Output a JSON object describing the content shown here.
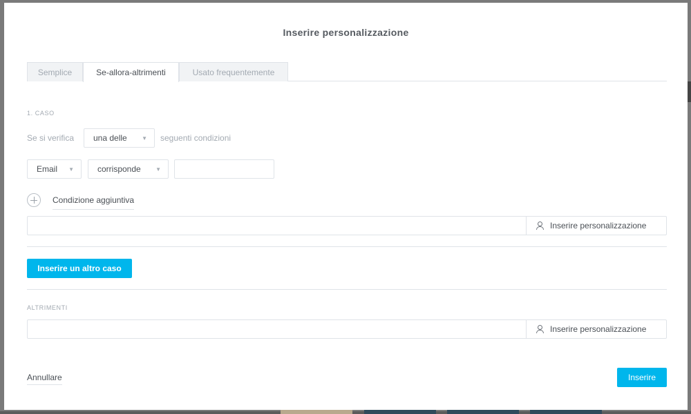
{
  "dialog": {
    "title": "Inserire personalizzazione"
  },
  "tabs": [
    {
      "label": "Semplice",
      "active": false
    },
    {
      "label": "Se-allora-altrimenti",
      "active": true
    },
    {
      "label": "Usato frequentemente",
      "active": false
    }
  ],
  "case": {
    "heading": "1. CASO",
    "prefix": "Se si verifica",
    "quantifier": "una delle",
    "suffix": "seguenti condizioni",
    "condition": {
      "field": "Email",
      "operator": "corrisponde",
      "value": ""
    },
    "add_condition_label": "Condizione aggiuntiva",
    "result_value": "",
    "personalize_label": "Inserire personalizzazione"
  },
  "add_case_button": "Inserire un altro caso",
  "else": {
    "heading": "ALTRIMENTI",
    "value": "",
    "personalize_label": "Inserire personalizzazione"
  },
  "footer": {
    "cancel_label": "Annullare",
    "insert_label": "Inserire"
  },
  "colors": {
    "accent": "#00b6ec",
    "border": "#dfe3e8",
    "muted_text": "#a3aab2"
  },
  "icons": {
    "add": "plus-circle-icon",
    "personalize": "person-icon",
    "dropdown": "chevron-down-icon"
  }
}
